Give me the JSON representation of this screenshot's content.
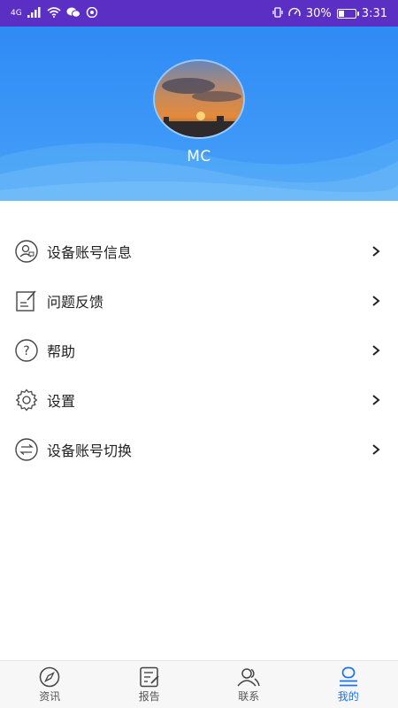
{
  "status_bar": {
    "network": "4G",
    "battery": "30%",
    "battery_level": 0.3,
    "time": "3:31"
  },
  "profile": {
    "username": "MC"
  },
  "menu": {
    "items": [
      {
        "label": "设备账号信息",
        "icon": "account-info-icon"
      },
      {
        "label": "问题反馈",
        "icon": "feedback-icon"
      },
      {
        "label": "帮助",
        "icon": "help-icon"
      },
      {
        "label": "设置",
        "icon": "gear-icon"
      },
      {
        "label": "设备账号切换",
        "icon": "switch-icon"
      }
    ]
  },
  "bottom_nav": {
    "tabs": [
      {
        "label": "资讯",
        "icon": "compass-icon"
      },
      {
        "label": "报告",
        "icon": "report-icon"
      },
      {
        "label": "联系",
        "icon": "contacts-icon"
      },
      {
        "label": "我的",
        "icon": "profile-icon",
        "active": true
      }
    ]
  },
  "colors": {
    "status_bar": "#5b2fc4",
    "header": "#2f8bf5",
    "active_tab": "#1a73e8"
  }
}
